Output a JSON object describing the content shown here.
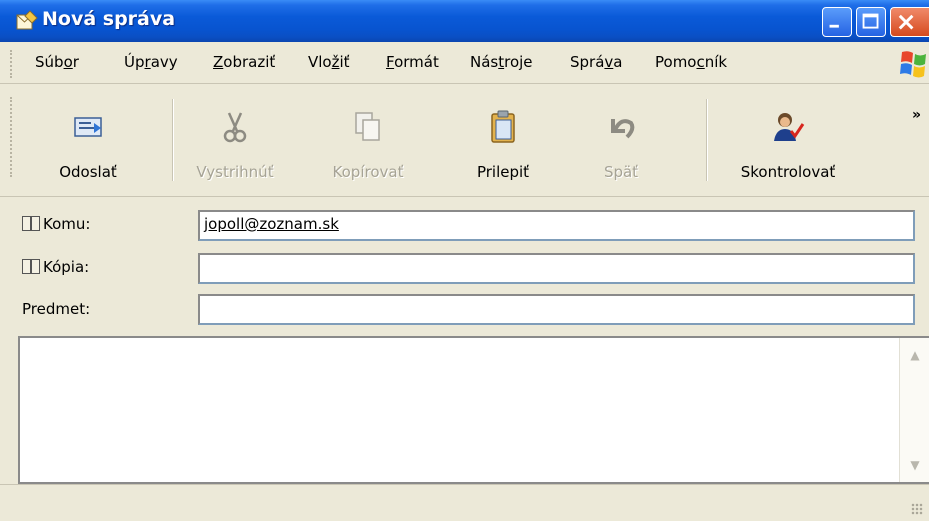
{
  "window": {
    "title": "Nová správa"
  },
  "menu": {
    "items": [
      {
        "pre": "Súb",
        "ul": "o",
        "post": "r"
      },
      {
        "pre": "Úp",
        "ul": "r",
        "post": "avy"
      },
      {
        "pre": "",
        "ul": "Z",
        "post": "obraziť"
      },
      {
        "pre": "Vlo",
        "ul": "ž",
        "post": "iť"
      },
      {
        "pre": "",
        "ul": "F",
        "post": "ormát"
      },
      {
        "pre": "Nás",
        "ul": "t",
        "post": "roje"
      },
      {
        "pre": "Sprá",
        "ul": "v",
        "post": "a"
      },
      {
        "pre": "Pomo",
        "ul": "c",
        "post": "ník"
      }
    ]
  },
  "toolbar": {
    "send_label": "Odoslať",
    "cut_label": "Vystrihnúť",
    "copy_label": "Kopírovať",
    "paste_label": "Prilepiť",
    "undo_label": "Späť",
    "check_label": "Skontrolovať",
    "more_chevron": "»"
  },
  "fields": {
    "to_label": "Komu:",
    "to_value": "jopoll@zoznam.sk",
    "cc_label": "Kópia:",
    "cc_value": "",
    "subject_label": "Predmet:",
    "subject_value": ""
  },
  "body": {
    "text": ""
  },
  "colors": {
    "titlebar_blue": "#0854d0",
    "chrome_beige": "#ece9d8",
    "close_red": "#d64a1e"
  },
  "icons": {
    "app": "new-message-icon",
    "send": "send-mail-icon",
    "cut": "scissors-icon",
    "copy": "copy-icon",
    "paste": "clipboard-icon",
    "undo": "undo-arrow-icon",
    "check": "spellcheck-person-icon",
    "address_book": "address-book-icon"
  }
}
